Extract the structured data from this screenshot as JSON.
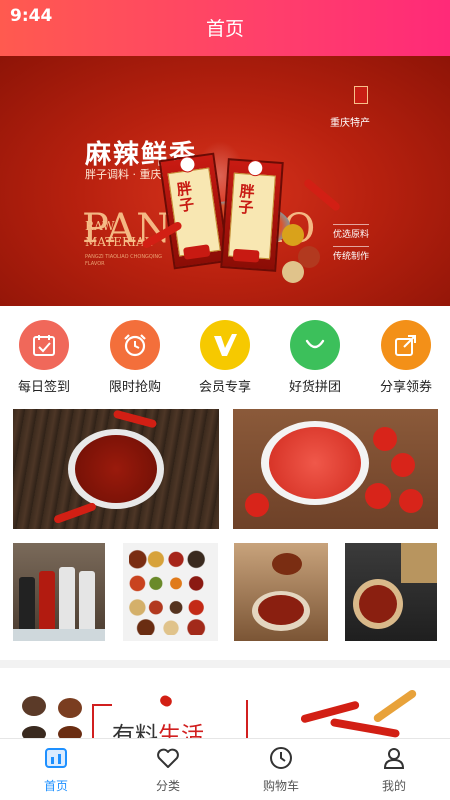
{
  "status_bar": {
    "time": "9:44"
  },
  "header": {
    "title": "首页"
  },
  "banner": {
    "title": "麻辣鲜香",
    "subtitle": "胖子调料 · 重庆味道",
    "big_text": "PANG      JIAO",
    "raw_material": [
      "RAW",
      "MATERIAL"
    ],
    "small_print": "PANGZI TIAOLIAO CHONGQING FLAVOR",
    "region": "重庆特产",
    "tags": [
      "优选原料",
      "传统制作"
    ],
    "pack_words": [
      "胖子",
      "胖子"
    ]
  },
  "quick_menu": [
    {
      "label": "每日签到",
      "icon": "calendar-check-icon",
      "color": "#f0685a"
    },
    {
      "label": "限时抢购",
      "icon": "alarm-clock-icon",
      "color": "#f36f3b"
    },
    {
      "label": "会员专享",
      "icon": "vip-v-icon",
      "color": "#f6c900"
    },
    {
      "label": "好货拼团",
      "icon": "smile-icon",
      "color": "#3cc05b"
    },
    {
      "label": "分享领券",
      "icon": "share-icon",
      "color": "#f39018"
    }
  ],
  "promo": {
    "text_plain": "有料",
    "text_highlight": "生活"
  },
  "tabbar": {
    "items": [
      {
        "label": "首页",
        "icon": "home-icon",
        "active": true
      },
      {
        "label": "分类",
        "icon": "heart-icon",
        "active": false
      },
      {
        "label": "购物车",
        "icon": "clock-icon",
        "active": false
      },
      {
        "label": "我的",
        "icon": "user-icon",
        "active": false
      }
    ],
    "active_color": "#1e90ff"
  }
}
